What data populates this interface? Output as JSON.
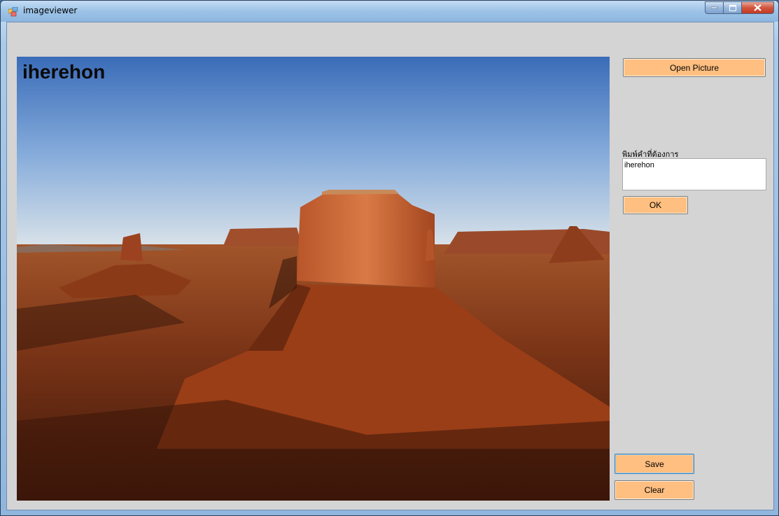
{
  "window": {
    "title": "imageviewer"
  },
  "picture": {
    "overlay_text": "iherehon"
  },
  "controls": {
    "open_picture_label": "Open Picture",
    "prompt_label": "พิมพ์คำที่ต้องการ",
    "text_value": "iherehon",
    "ok_label": "OK",
    "save_label": "Save",
    "clear_label": "Clear"
  },
  "colors": {
    "button_fill": "#ffbf80",
    "form_background": "#d4d4d4"
  }
}
